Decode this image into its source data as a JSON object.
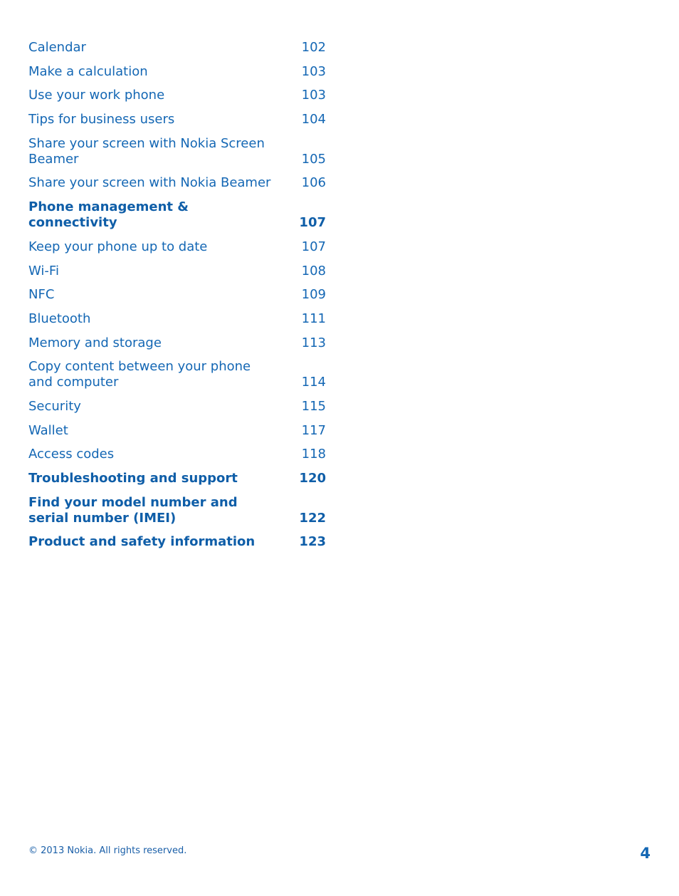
{
  "toc": [
    {
      "title": "Calendar",
      "page": "102",
      "bold": false
    },
    {
      "title": "Make a calculation",
      "page": "103",
      "bold": false
    },
    {
      "title": "Use your work phone",
      "page": "103",
      "bold": false
    },
    {
      "title": "Tips for business users",
      "page": "104",
      "bold": false
    },
    {
      "title": "Share your screen with Nokia Screen Beamer",
      "page": "105",
      "bold": false
    },
    {
      "title": "Share your screen with Nokia Beamer",
      "page": "106",
      "bold": false
    },
    {
      "title": "Phone management & connectivity",
      "page": "107",
      "bold": true
    },
    {
      "title": "Keep your phone up to date",
      "page": "107",
      "bold": false
    },
    {
      "title": "Wi-Fi",
      "page": "108",
      "bold": false
    },
    {
      "title": "NFC",
      "page": "109",
      "bold": false
    },
    {
      "title": "Bluetooth",
      "page": "111",
      "bold": false
    },
    {
      "title": "Memory and storage",
      "page": "113",
      "bold": false
    },
    {
      "title": "Copy content between your phone and computer",
      "page": "114",
      "bold": false
    },
    {
      "title": "Security",
      "page": "115",
      "bold": false
    },
    {
      "title": "Wallet",
      "page": "117",
      "bold": false
    },
    {
      "title": "Access codes",
      "page": "118",
      "bold": false
    },
    {
      "title": "Troubleshooting and support",
      "page": "120",
      "bold": true
    },
    {
      "title": "Find your model number and serial number (IMEI)",
      "page": "122",
      "bold": true
    },
    {
      "title": "Product and safety information",
      "page": "123",
      "bold": true
    }
  ],
  "footer": {
    "copyright": "© 2013 Nokia. All rights reserved.",
    "page_number": "4"
  }
}
